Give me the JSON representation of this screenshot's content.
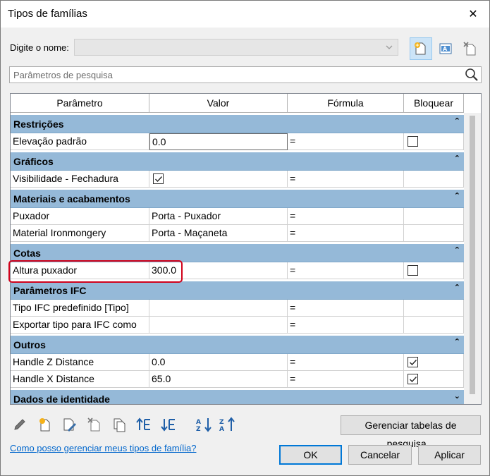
{
  "window": {
    "title": "Tipos de famílias",
    "close_glyph": "✕"
  },
  "name_label": "Digite o nome:",
  "name_value": "",
  "search": {
    "placeholder": "Parâmetros de pesquisa"
  },
  "columns": [
    "Parâmetro",
    "Valor",
    "Fórmula",
    "Bloquear"
  ],
  "groups": [
    {
      "label": "Restrições",
      "rows": [
        {
          "param": "Elevação padrão",
          "value": "0.0",
          "formula": "=",
          "lock": "unchecked",
          "editing": true
        }
      ]
    },
    {
      "label": "Gráficos",
      "rows": [
        {
          "param": "Visibilidade - Fechadura",
          "value_check": "checked",
          "formula": "=",
          "lock": "none"
        }
      ]
    },
    {
      "label": "Materiais e acabamentos",
      "rows": [
        {
          "param": "Puxador",
          "value": "Porta - Puxador",
          "formula": "=",
          "lock": "none"
        },
        {
          "param": "Material Ironmongery",
          "value": "Porta - Maçaneta",
          "formula": "=",
          "lock": "none"
        }
      ]
    },
    {
      "label": "Cotas",
      "rows": [
        {
          "param": "Altura puxador",
          "value": "300.0",
          "formula": "=",
          "lock": "unchecked"
        }
      ]
    },
    {
      "label": "Parâmetros IFC",
      "rows": [
        {
          "param": "Tipo IFC predefinido [Tipo]",
          "value": "",
          "formula": "=",
          "lock": "none"
        },
        {
          "param": "Exportar tipo para IFC como",
          "value": "",
          "formula": "=",
          "lock": "none"
        }
      ]
    },
    {
      "label": "Outros",
      "rows": [
        {
          "param": "Handle Z Distance",
          "value": "0.0",
          "formula": "=",
          "lock": "checked"
        },
        {
          "param": "Handle X Distance",
          "value": "65.0",
          "formula": "=",
          "lock": "checked"
        }
      ]
    },
    {
      "label": "Dados de identidade",
      "rows": []
    }
  ],
  "toolbar_icons": [
    "pencil-icon",
    "new-parameter-icon",
    "edit-parameter-icon",
    "delete-parameter-icon",
    "copy-parameter-icon",
    "move-up-icon",
    "move-down-icon",
    "sort-ascending-icon",
    "sort-descending-icon"
  ],
  "buttons": {
    "manage_lookup": "Gerenciar tabelas de pesquisa...",
    "ok": "OK",
    "cancel": "Cancelar",
    "apply": "Aplicar"
  },
  "help_link": "Como posso gerenciar meus tipos de família?",
  "colors": {
    "group_header": "#95b9d8",
    "highlight": "#d0021b",
    "accent": "#0078d7"
  }
}
